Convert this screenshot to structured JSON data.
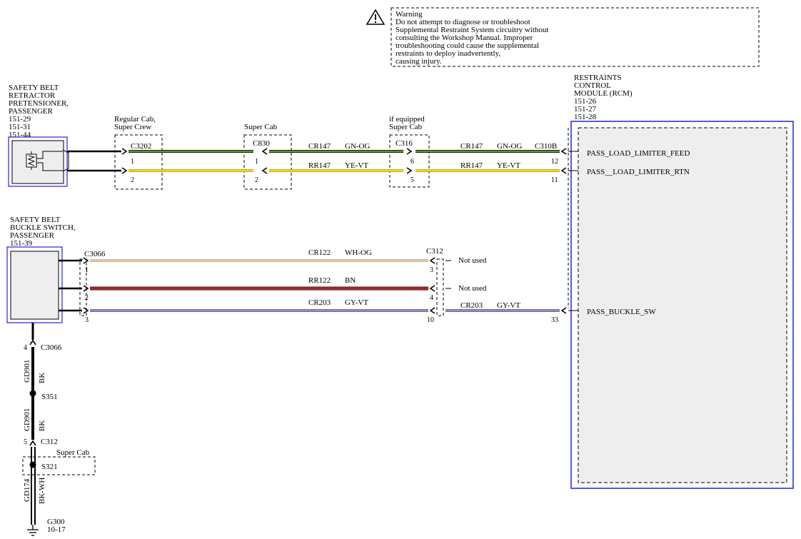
{
  "warning": {
    "lines": [
      "Warning",
      "Do not attempt to diagnose or troubleshoot",
      "Supplemental Restraint System circuitry without",
      "consulting the Workshop Manual. Improper",
      "troubleshooting could cause the supplemental",
      "restraints to deploy inadvertently,",
      "causing injury."
    ]
  },
  "components": {
    "retractor": [
      "SAFETY BELT",
      "RETRACTOR",
      "PRETENSIONER,",
      "PASSENGER",
      "151-29",
      "151-31",
      "151-44"
    ],
    "buckle": [
      "SAFETY BELT",
      "BUCKLE SWITCH,",
      "PASSENGER",
      "151-39"
    ],
    "rcm": [
      "RESTRAINTS",
      "CONTROL",
      "MODULE (RCM)",
      "151-26",
      "151-27",
      "151-28"
    ]
  },
  "notes": {
    "regular_cab": [
      "Regular Cab,",
      "Super Crew"
    ],
    "super_cab_c830": "Super Cab",
    "c316_note": [
      "if equipped",
      "Super Cab"
    ],
    "super_cab_s321": "Super Cab",
    "not_used_1": "Not used",
    "not_used_2": "Not used"
  },
  "connectors": {
    "c3202": "C3202",
    "c830": "C830",
    "c316": "C316",
    "c310b": "C310B",
    "c3066_top": "C3066",
    "c312_top": "C312",
    "c3066_bottom": "C3066",
    "c312_bottom": "C312"
  },
  "pins": {
    "c3202_1": "1",
    "c3202_2": "2",
    "c830_1": "1",
    "c830_2": "2",
    "c316_6": "6",
    "c316_5": "5",
    "c310b_12": "12",
    "c310b_11": "11",
    "c3066_1": "1",
    "c3066_2": "2",
    "c3066_3": "3",
    "c312_3": "3",
    "c312_4": "4",
    "c312_10": "10",
    "rcm_33": "33",
    "c3066_4": "4",
    "c312_5": "5"
  },
  "circuits": {
    "w1_left_id": "CR147",
    "w1_left_color": "GN-OG",
    "w1_right_id": "CR147",
    "w1_right_color": "GN-OG",
    "w2_left_id": "RR147",
    "w2_left_color": "YE-VT",
    "w2_right_id": "RR147",
    "w2_right_color": "YE-VT",
    "w3_id": "CR122",
    "w3_color": "WH-OG",
    "w4_id": "RR122",
    "w4_color": "BN",
    "w5_id": "CR203",
    "w5_color": "GY-VT",
    "w5_right_id": "CR203",
    "w5_right_color": "GY-VT",
    "g1_id": "GD901",
    "g1_color": "BK",
    "g2_id": "GD901",
    "g2_color": "BK",
    "g3_id": "GD174",
    "g3_color": "BK-WH"
  },
  "signals": {
    "feed": "PASS_LOAD_LIMITER_FEED",
    "rtn": "PASS__LOAD_LIMITER_RTN",
    "buckle_sw": "PASS_BUCKLE_SW"
  },
  "splices": {
    "s351": "S351",
    "s321": "S321"
  },
  "ground": {
    "id": "G300",
    "ref": "10-17"
  },
  "colors": {
    "green": "#5a9a2a",
    "yellow": "#f2d336",
    "white_orange": "#f3c58a",
    "brown": "#a0282a",
    "gray_violet": "#8f8fbf",
    "blue_border": "#2222dd",
    "module_fill": "#eeeeee"
  }
}
